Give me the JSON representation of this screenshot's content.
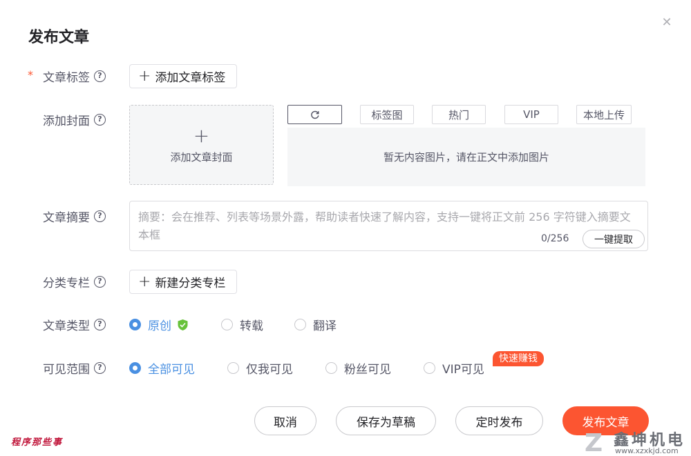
{
  "dialog": {
    "title": "发布文章",
    "close_icon": "close-icon"
  },
  "tags": {
    "required_mark": "*",
    "label": "文章标签",
    "add_label": "添加文章标签"
  },
  "cover": {
    "label": "添加封面",
    "upload_label": "添加文章封面",
    "tabs": [
      "标签图",
      "热门",
      "VIP",
      "本地上传"
    ],
    "refresh_icon": "refresh-icon",
    "empty_text": "暂无内容图片，请在正文中添加图片"
  },
  "abstract": {
    "label": "文章摘要",
    "placeholder": "摘要：会在推荐、列表等场景外露，帮助读者快速了解内容，支持一键将正文前 256 字符键入摘要文本框",
    "count": "0/256",
    "extract_label": "一键提取"
  },
  "column": {
    "label": "分类专栏",
    "new_label": "新建分类专栏"
  },
  "type": {
    "label": "文章类型",
    "options": [
      "原创",
      "转载",
      "翻译"
    ],
    "selected": "原创"
  },
  "visibility": {
    "label": "可见范围",
    "options": [
      "全部可见",
      "仅我可见",
      "粉丝可见",
      "VIP可见"
    ],
    "selected": "全部可见",
    "promo_badge": "快速赚钱"
  },
  "footer": {
    "cancel": "取消",
    "save_draft": "保存为草稿",
    "schedule": "定时发布",
    "publish": "发布文章"
  },
  "watermarks": {
    "left": "程序那些事",
    "right_logo": "Z",
    "right_name": "鑫坤机电",
    "right_url": "www.xzxkjd.com"
  },
  "colors": {
    "accent": "#fc5531",
    "radio_selected": "#4a90e2",
    "shield_green": "#67c23a"
  }
}
